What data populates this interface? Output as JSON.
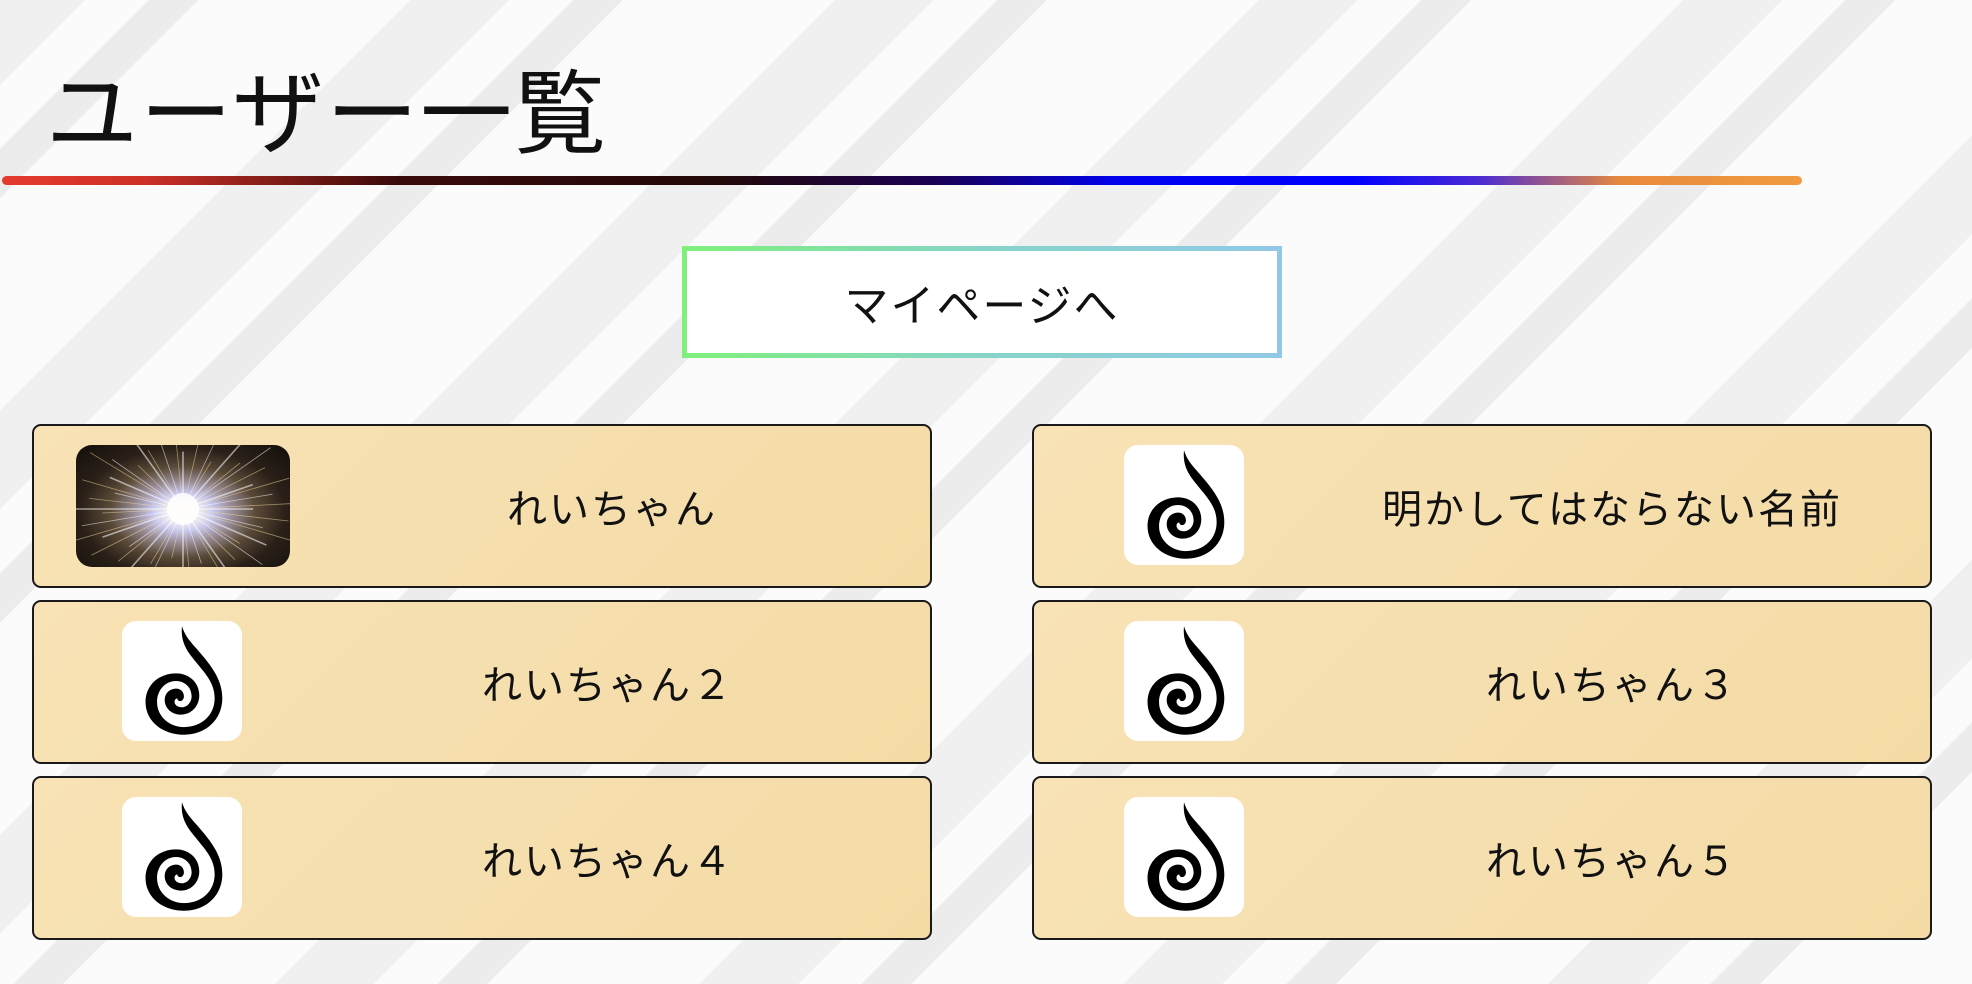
{
  "page": {
    "title": "ユーザー一覧"
  },
  "mypage_button": {
    "label": "マイページへ"
  },
  "colors": {
    "card_background": "#f7e0b0",
    "card_border": "#1a1a1a",
    "button_border_start": "#7ef07a",
    "button_border_end": "#90c8e6",
    "rule_red": "#e63a2e",
    "rule_blue": "#0000ff",
    "rule_orange": "#ef9a40"
  },
  "users": [
    {
      "name": "れいちゃん",
      "avatar": "starburst-image"
    },
    {
      "name": "明かしてはならない名前",
      "avatar": "spiral-flame-icon"
    },
    {
      "name": "れいちゃん２",
      "avatar": "spiral-flame-icon"
    },
    {
      "name": "れいちゃん３",
      "avatar": "spiral-flame-icon"
    },
    {
      "name": "れいちゃん４",
      "avatar": "spiral-flame-icon"
    },
    {
      "name": "れいちゃん５",
      "avatar": "spiral-flame-icon"
    }
  ]
}
